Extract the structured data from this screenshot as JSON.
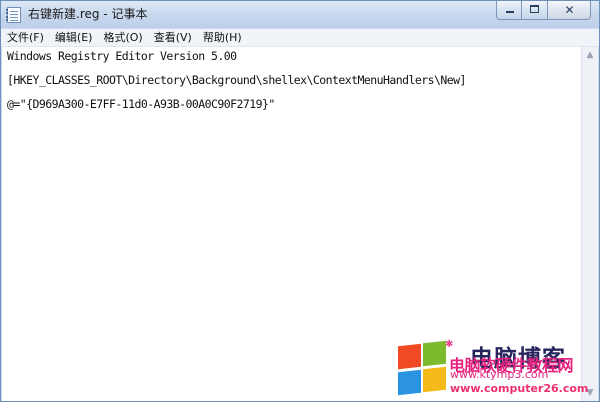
{
  "window": {
    "title": "右键新建.reg - 记事本"
  },
  "caption_buttons": {
    "close_glyph": "✕"
  },
  "menu": {
    "items": [
      {
        "label": "文件(F)"
      },
      {
        "label": "编辑(E)"
      },
      {
        "label": "格式(O)"
      },
      {
        "label": "查看(V)"
      },
      {
        "label": "帮助(H)"
      }
    ]
  },
  "editor": {
    "lines": [
      "Windows Registry Editor Version 5.00",
      "[HKEY_CLASSES_ROOT\\Directory\\Background\\shellex\\ContextMenuHandlers\\New]",
      "@=\"{D969A300-E7FF-11d0-A93B-00A0C90F2719}\""
    ]
  },
  "scrollbar": {
    "up_glyph": "▲",
    "down_glyph": "▼"
  },
  "watermark": {
    "title": "电脑博客",
    "subtitle": "电脑软硬件教程网",
    "url1": "www.ktymp3.com",
    "url2": "www.computer26.com",
    "logo_colors": [
      "#ef4a23",
      "#7dbb2e",
      "#2a93e2",
      "#f6b91a"
    ]
  },
  "colors": {
    "title_bar": "#c9d9ee",
    "menu_bar": "#f0f4f9",
    "editor_bg": "#ffffff"
  }
}
